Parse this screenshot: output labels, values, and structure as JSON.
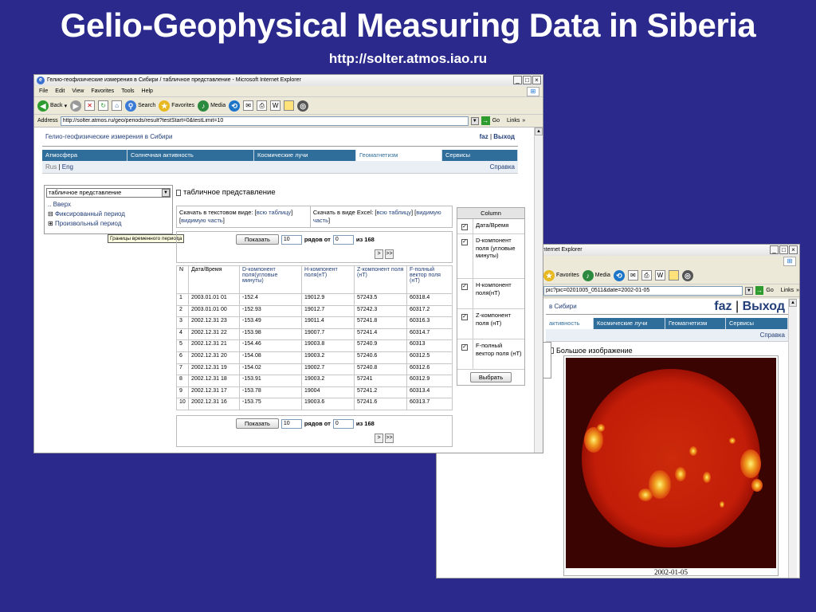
{
  "slide": {
    "title": "Gelio-Geophysical Measuring Data in Siberia",
    "url": "http://solter.atmos.iao.ru"
  },
  "win1": {
    "title": "Гелио-геофизические измерения в Сибири / табличное представление - Microsoft Internet Explorer",
    "menu": [
      "File",
      "Edit",
      "View",
      "Favorites",
      "Tools",
      "Help"
    ],
    "toolbar": {
      "back": "Back",
      "search": "Search",
      "favorites": "Favorites",
      "media": "Media"
    },
    "address_label": "Address",
    "address": "http://solter.atmos.ru/geo/periods/result?testStart=0&testLimit=10",
    "go": "Go",
    "links": "Links",
    "site_title": "Гелио-геофизические измерения в Сибири",
    "user": "faz",
    "sep": "|",
    "logout": "Выход",
    "nav": [
      "Атмосфера",
      "Солнечная активность",
      "Космические лучи",
      "Геомагнетизм",
      "Сервисы"
    ],
    "lang_ru": "Rus",
    "lang_en": "Eng",
    "help": "Справка",
    "view_select": "табличное представление",
    "tree": {
      "up": ".. Вверх",
      "fixed": "Фиксированный период",
      "arbitrary": "Произвольный период"
    },
    "tooltip": "Границы временного периода",
    "section_title": "табличное представление",
    "download_text": {
      "label": "Скачать в текстовом виде:",
      "all": "всю таблицу",
      "visible": "видимую часть"
    },
    "download_excel": {
      "label": "Скачать в виде Excel:",
      "all": "всю таблицу",
      "visible": "видимую часть"
    },
    "pager": {
      "show": "Показать",
      "count": "10",
      "rows_from": "рядов от",
      "start": "0",
      "of": "из 168",
      "next": ">",
      "last": ">>"
    },
    "headers": [
      "N",
      "Дата/Время",
      "D-компонент поля(угловые минуты)",
      "H-компонент поля(нТ)",
      "Z-компонент поля (нТ)",
      "F-полный вектор поля (нТ)"
    ],
    "rows": [
      [
        "1",
        "2003.01.01 01",
        "-152.4",
        "19012.9",
        "57243.5",
        "60318.4"
      ],
      [
        "2",
        "2003.01.01 00",
        "-152.93",
        "19012.7",
        "57242.3",
        "60317.2"
      ],
      [
        "3",
        "2002.12.31 23",
        "-153.49",
        "19011.4",
        "57241.8",
        "60316.3"
      ],
      [
        "4",
        "2002.12.31 22",
        "-153.98",
        "19007.7",
        "57241.4",
        "60314.7"
      ],
      [
        "5",
        "2002.12.31 21",
        "-154.46",
        "19003.8",
        "57240.9",
        "60313"
      ],
      [
        "6",
        "2002.12.31 20",
        "-154.08",
        "19003.2",
        "57240.6",
        "60312.5"
      ],
      [
        "7",
        "2002.12.31 19",
        "-154.02",
        "19002.7",
        "57240.8",
        "60312.6"
      ],
      [
        "8",
        "2002.12.31 18",
        "-153.91",
        "19003.2",
        "57241",
        "60312.9"
      ],
      [
        "9",
        "2002.12.31 17",
        "-153.78",
        "19004",
        "57241.2",
        "60313.4"
      ],
      [
        "10",
        "2002.12.31 16",
        "-153.75",
        "19003.6",
        "57241.6",
        "60313.7"
      ]
    ],
    "columns_panel": {
      "title": "Column",
      "items": [
        "Дата/Время",
        "D-компонент поля (угловые минуты)",
        "H-компонент поля(нТ)",
        "Z-компонент поля (нТ)",
        "F-полный вектор поля (нТ)"
      ],
      "choose": "Выбрать"
    }
  },
  "win2": {
    "title": "/ Большое изображение - Microsoft Internet Explorer",
    "toolbar": {
      "favorites": "Favorites",
      "media": "Media"
    },
    "address": "pic?pic=0201005_0511&date=2002-01-05",
    "go": "Go",
    "links": "Links",
    "site_title": "в Сибири",
    "user": "faz",
    "sep": "|",
    "logout": "Выход",
    "nav": [
      "активность",
      "Космические лучи",
      "Геомагнетизм",
      "Сервисы"
    ],
    "help": "Справка",
    "section_title": "Большое изображение",
    "image_date": "2002-01-05"
  },
  "colors": {
    "background": "#2b2a8c",
    "nav": "#2f6e9a",
    "sun": "#c8200a"
  }
}
